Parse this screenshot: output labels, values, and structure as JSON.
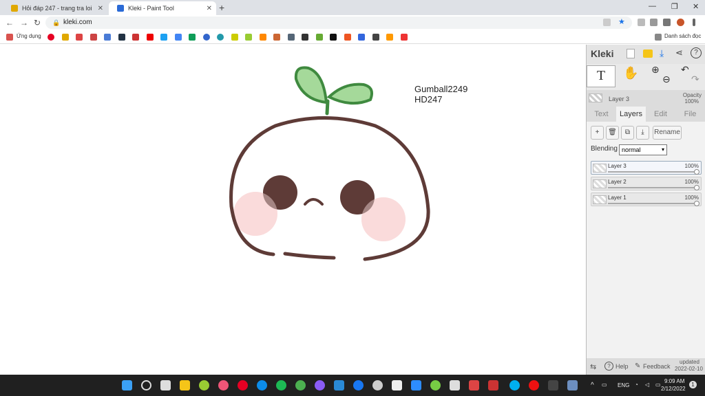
{
  "browser": {
    "tabs": [
      {
        "title": "Hỏi đáp 247 - trang tra loi",
        "favicon_color": "#e0a800"
      },
      {
        "title": "Kleki - Paint Tool",
        "favicon_color": "#2a6ad6"
      }
    ],
    "close_glyph": "✕",
    "newtab_glyph": "+",
    "window_controls": [
      "—",
      "❐",
      "✕"
    ],
    "nav": [
      "←",
      "→",
      "↻"
    ],
    "url": "kleki.com",
    "lock_glyph": "🔒",
    "bookmarks_apps_label": "Ứng dụng",
    "reading_list_label": "Danh sách đọc"
  },
  "canvas": {
    "text_line1": "Gumball2249",
    "text_line2": "HD247",
    "colors": {
      "outline": "#5a3a36",
      "sprout_fill": "#a5d99a",
      "sprout_stroke": "#3f8a3f",
      "blush": "#f8cccc"
    }
  },
  "kleki": {
    "logo": "Kleki",
    "tool_text_glyph": "T",
    "tool_hand_glyph": "✋",
    "current_layer": "Layer 3",
    "opacity_label": "Opacity",
    "opacity_value": "100%",
    "tabs": [
      "Text",
      "Layers",
      "Edit",
      "File"
    ],
    "active_tab": "Layers",
    "layer_buttons": [
      "+",
      "🗑",
      "⧉",
      "⤓"
    ],
    "rename_label": "Rename",
    "blending_label": "Blending",
    "blending_value": "normal",
    "layers": [
      {
        "name": "Layer 3",
        "opacity": "100%",
        "selected": true
      },
      {
        "name": "Layer 2",
        "opacity": "100%",
        "selected": false
      },
      {
        "name": "Layer 1",
        "opacity": "100%",
        "selected": false
      }
    ],
    "footer": {
      "help": "Help",
      "feedback": "Feedback",
      "updated_label": "updated",
      "updated_date": "2022-02-10"
    }
  },
  "taskbar": {
    "lang": "ENG",
    "time": "9:09 AM",
    "date": "2/12/2022",
    "notif_count": "1"
  }
}
